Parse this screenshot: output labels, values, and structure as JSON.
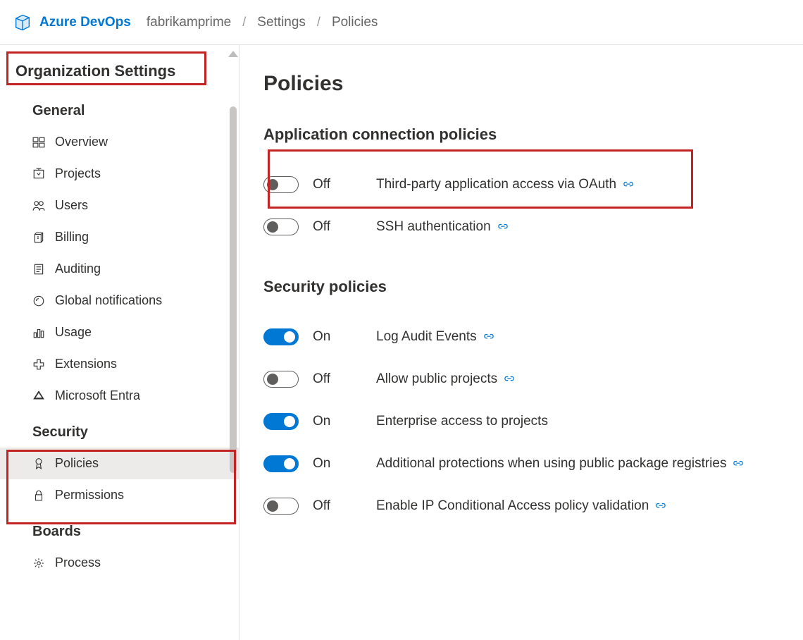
{
  "header": {
    "brand": "Azure DevOps",
    "breadcrumbs": [
      "fabrikamprime",
      "Settings",
      "Policies"
    ]
  },
  "sidebar": {
    "title": "Organization Settings",
    "sections": [
      {
        "label": "General",
        "items": [
          {
            "label": "Overview",
            "icon": "overview"
          },
          {
            "label": "Projects",
            "icon": "projects"
          },
          {
            "label": "Users",
            "icon": "users"
          },
          {
            "label": "Billing",
            "icon": "billing"
          },
          {
            "label": "Auditing",
            "icon": "auditing"
          },
          {
            "label": "Global notifications",
            "icon": "notifications"
          },
          {
            "label": "Usage",
            "icon": "usage"
          },
          {
            "label": "Extensions",
            "icon": "extensions"
          },
          {
            "label": "Microsoft Entra",
            "icon": "entra"
          }
        ]
      },
      {
        "label": "Security",
        "items": [
          {
            "label": "Policies",
            "icon": "policies",
            "selected": true
          },
          {
            "label": "Permissions",
            "icon": "permissions"
          }
        ]
      },
      {
        "label": "Boards",
        "items": [
          {
            "label": "Process",
            "icon": "process"
          }
        ]
      }
    ]
  },
  "main": {
    "title": "Policies",
    "sections": [
      {
        "title": "Application connection policies",
        "policies": [
          {
            "label": "Third-party application access via OAuth",
            "on": false,
            "stateText": "Off",
            "link": true
          },
          {
            "label": "SSH authentication",
            "on": false,
            "stateText": "Off",
            "link": true
          }
        ]
      },
      {
        "title": "Security policies",
        "policies": [
          {
            "label": "Log Audit Events",
            "on": true,
            "stateText": "On",
            "link": true
          },
          {
            "label": "Allow public projects",
            "on": false,
            "stateText": "Off",
            "link": true
          },
          {
            "label": "Enterprise access to projects",
            "on": true,
            "stateText": "On",
            "link": false
          },
          {
            "label": "Additional protections when using public package registries",
            "on": true,
            "stateText": "On",
            "link": true
          },
          {
            "label": "Enable IP Conditional Access policy validation",
            "on": false,
            "stateText": "Off",
            "link": true
          }
        ]
      }
    ]
  }
}
